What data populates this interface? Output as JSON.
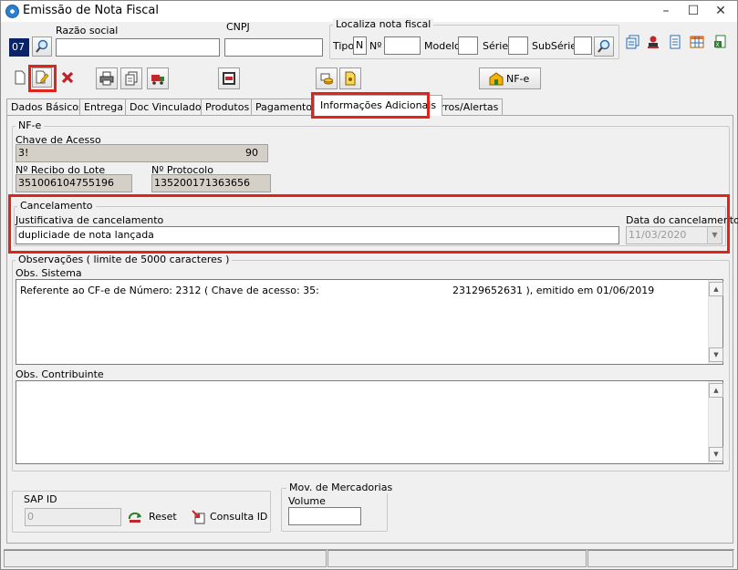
{
  "window": {
    "title": "Emissão de Nota Fiscal",
    "minimize": "–",
    "maximize": "☐",
    "close": "✕"
  },
  "header": {
    "code_value": "07",
    "razao_social_label": "Razão social",
    "razao_social_value": "",
    "cnpj_label": "CNPJ",
    "cnpj_value": "",
    "localiza_title": "Localiza nota fiscal",
    "tipo_label": "Tipo",
    "tipo_value": "N",
    "numero_label": "Nº",
    "numero_value": "",
    "modelo_label": "Modelo",
    "modelo_value": "",
    "serie_label": "Série",
    "serie_value": "",
    "subserie_label": "SubSérie",
    "subserie_value": ""
  },
  "toolbar": {
    "nfe_label": "NF-e"
  },
  "tabs": [
    {
      "label": "Dados Básicos"
    },
    {
      "label": "Entrega"
    },
    {
      "label": "Doc Vinculados"
    },
    {
      "label": "Produtos"
    },
    {
      "label": "Pagamentos"
    },
    {
      "label": "Informações Adicionais"
    },
    {
      "label": "Erros/Alertas"
    }
  ],
  "nfe": {
    "title": "NF-e",
    "chave_label": "Chave de Acesso",
    "chave_value_start": "3!",
    "chave_value_end": "90",
    "recibo_label": "Nº Recibo do Lote",
    "recibo_value": "351006104755196",
    "protocolo_label": "Nº Protocolo",
    "protocolo_value": "135200171363656"
  },
  "cancelamento": {
    "title": "Cancelamento",
    "justificativa_label": "Justificativa de cancelamento",
    "justificativa_value": "dupliciade de nota lançada",
    "data_label": "Data do cancelamento",
    "data_value": "11/03/2020"
  },
  "observacoes": {
    "title": "Observações ( limite de 5000 caracteres )",
    "sistema_label": "Obs. Sistema",
    "sistema_text_part1": "Referente ao CF-e de Número: 2312 ( Chave de acesso: 35:",
    "sistema_text_part2": "23129652631 ), emitido em 01/06/2019",
    "contribuinte_label": "Obs. Contribuinte",
    "contribuinte_text": ""
  },
  "sap": {
    "title": "SAP ID",
    "value": "0",
    "reset_label": "Reset",
    "consulta_label": "Consulta ID"
  },
  "mercadorias": {
    "title": "Mov. de Mercadorias",
    "volume_label": "Volume",
    "volume_value": ""
  },
  "colors": {
    "highlight": "#e2231a",
    "window_bg": "#f0f0f0"
  }
}
